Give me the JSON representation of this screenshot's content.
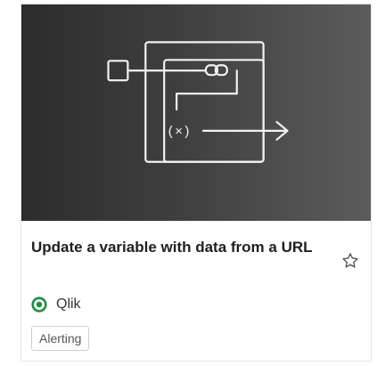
{
  "card": {
    "title": "Update a variable with data from a URL",
    "publisher": "Qlik",
    "tag": "Alerting",
    "icons": {
      "hero": "workflow-diagram-icon",
      "favorite": "star-outline-icon",
      "publisher": "qlik-dot-icon"
    },
    "hero_label": "(×)",
    "colors": {
      "hero_bg": "#3a3a3a",
      "publisher_green": "#1c8f3c"
    }
  }
}
